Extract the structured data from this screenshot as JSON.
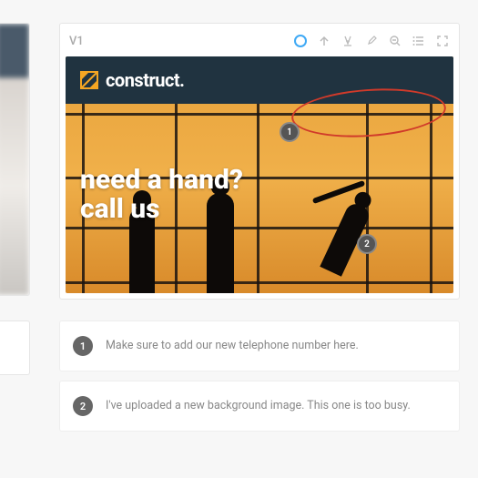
{
  "version_label": "V1",
  "toolbar": {
    "circle": "circle-tool",
    "arrow": "arrow-tool",
    "text": "text-color-tool",
    "eyedropper": "eyedropper-tool",
    "zoom": "zoom-tool",
    "list": "list-tool",
    "fullscreen": "fullscreen-tool"
  },
  "preview": {
    "brand_name": "construct.",
    "hero_line1": "need a hand?",
    "hero_line2": "call us",
    "markers": {
      "m1": "1",
      "m2": "2"
    }
  },
  "comments": [
    {
      "num": "1",
      "text": "Make sure to add our new telephone number here."
    },
    {
      "num": "2",
      "text": "I've uploaded a new background image. This one is too busy."
    }
  ]
}
